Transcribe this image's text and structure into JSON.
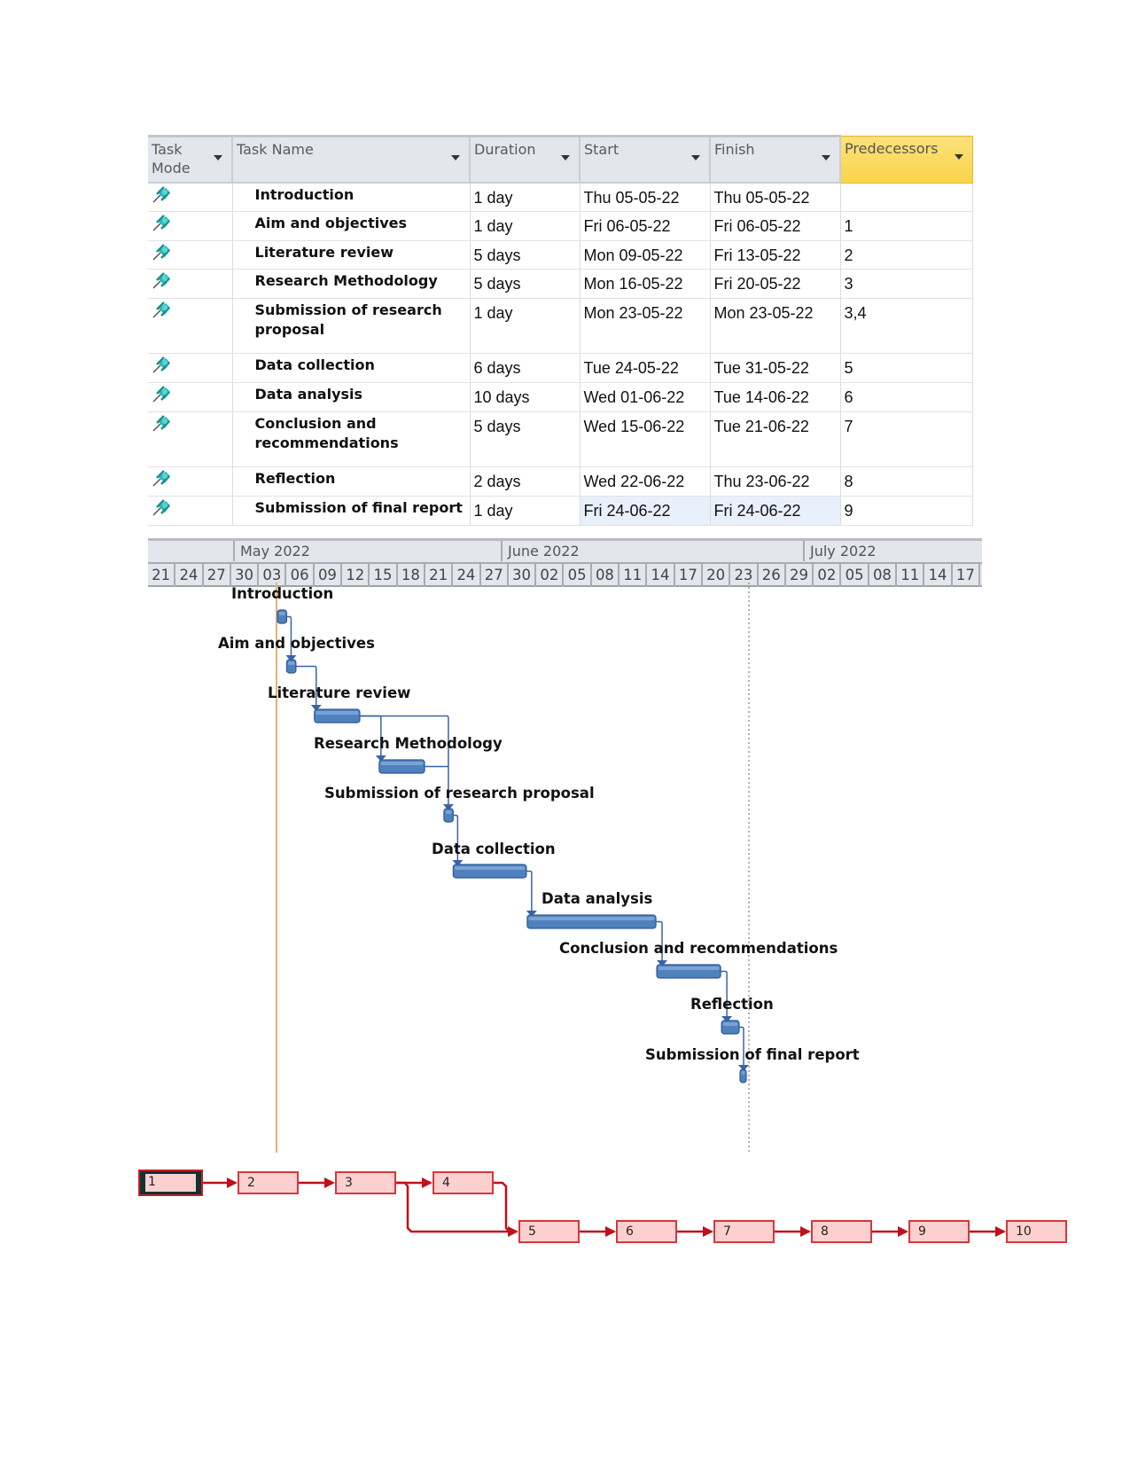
{
  "table": {
    "columns": [
      {
        "label": "Task Mode",
        "label_line1": "Task",
        "label_line2": "Mode"
      },
      {
        "label": "Task Name"
      },
      {
        "label": "Duration"
      },
      {
        "label": "Start"
      },
      {
        "label": "Finish"
      },
      {
        "label": "Predecessors"
      }
    ],
    "rows": [
      {
        "id": 1,
        "mode_icon": "pin-icon",
        "name": "Introduction",
        "duration": "1 day",
        "start": "Thu 05-05-22",
        "finish": "Thu 05-05-22",
        "predecessors": ""
      },
      {
        "id": 2,
        "mode_icon": "pin-icon",
        "name": "Aim and objectives",
        "duration": "1 day",
        "start": "Fri 06-05-22",
        "finish": "Fri 06-05-22",
        "predecessors": "1"
      },
      {
        "id": 3,
        "mode_icon": "pin-icon",
        "name": "Literature review",
        "duration": "5 days",
        "start": "Mon 09-05-22",
        "finish": "Fri 13-05-22",
        "predecessors": "2"
      },
      {
        "id": 4,
        "mode_icon": "pin-icon",
        "name": "Research Methodology",
        "duration": "5 days",
        "start": "Mon 16-05-22",
        "finish": "Fri 20-05-22",
        "predecessors": "3"
      },
      {
        "id": 5,
        "mode_icon": "pin-icon",
        "name": "Submission of research proposal",
        "name_line1": "Submission of research",
        "name_line2": "proposal",
        "duration": "1 day",
        "start": "Mon 23-05-22",
        "finish": "Mon 23-05-22",
        "predecessors": "3,4"
      },
      {
        "id": 6,
        "mode_icon": "pin-icon",
        "name": "Data collection",
        "duration": "6 days",
        "start": "Tue 24-05-22",
        "finish": "Tue 31-05-22",
        "predecessors": "5"
      },
      {
        "id": 7,
        "mode_icon": "pin-icon",
        "name": "Data analysis",
        "duration": "10 days",
        "start": "Wed 01-06-22",
        "finish": "Tue 14-06-22",
        "predecessors": "6"
      },
      {
        "id": 8,
        "mode_icon": "pin-icon",
        "name": "Conclusion and recommendations",
        "name_line1": "Conclusion and",
        "name_line2": "recommendations",
        "duration": "5 days",
        "start": "Wed 15-06-22",
        "finish": "Tue 21-06-22",
        "predecessors": "7"
      },
      {
        "id": 9,
        "mode_icon": "pin-icon",
        "name": "Reflection",
        "duration": "2 days",
        "start": "Wed 22-06-22",
        "finish": "Thu 23-06-22",
        "predecessors": "8"
      },
      {
        "id": 10,
        "mode_icon": "pin-icon",
        "name": "Submission of final report",
        "duration": "1 day",
        "start": "Fri 24-06-22",
        "finish": "Fri 24-06-22",
        "predecessors": "9",
        "selected": true
      }
    ]
  },
  "timescale": {
    "months": [
      "May 2022",
      "June 2022",
      "July 2022"
    ],
    "ticks": [
      "21",
      "24",
      "27",
      "30",
      "03",
      "06",
      "09",
      "12",
      "15",
      "18",
      "21",
      "24",
      "27",
      "30",
      "02",
      "05",
      "08",
      "11",
      "14",
      "17",
      "20",
      "23",
      "26",
      "29",
      "02",
      "05",
      "08",
      "11",
      "14",
      "17"
    ]
  },
  "gantt": {
    "bar_color": "#4f81bd",
    "today_line_color": "#e8b070",
    "bars": [
      {
        "label": "Introduction",
        "start": "2022-05-05",
        "finish": "2022-05-05"
      },
      {
        "label": "Aim and objectives",
        "start": "2022-05-06",
        "finish": "2022-05-06"
      },
      {
        "label": "Literature review",
        "start": "2022-05-09",
        "finish": "2022-05-13"
      },
      {
        "label": "Research Methodology",
        "start": "2022-05-16",
        "finish": "2022-05-20"
      },
      {
        "label": "Submission of research proposal",
        "start": "2022-05-23",
        "finish": "2022-05-23"
      },
      {
        "label": "Data collection",
        "start": "2022-05-24",
        "finish": "2022-05-31"
      },
      {
        "label": "Data analysis",
        "start": "2022-06-01",
        "finish": "2022-06-14"
      },
      {
        "label": "Conclusion and recommendations",
        "start": "2022-06-15",
        "finish": "2022-06-21"
      },
      {
        "label": "Reflection",
        "start": "2022-06-22",
        "finish": "2022-06-23"
      },
      {
        "label": "Submission of final report",
        "start": "2022-06-24",
        "finish": "2022-06-24"
      }
    ]
  },
  "network": {
    "line_color": "#c0101a",
    "nodes": [
      "1",
      "2",
      "3",
      "4",
      "5",
      "6",
      "7",
      "8",
      "9",
      "10"
    ],
    "selected_node": "1"
  }
}
